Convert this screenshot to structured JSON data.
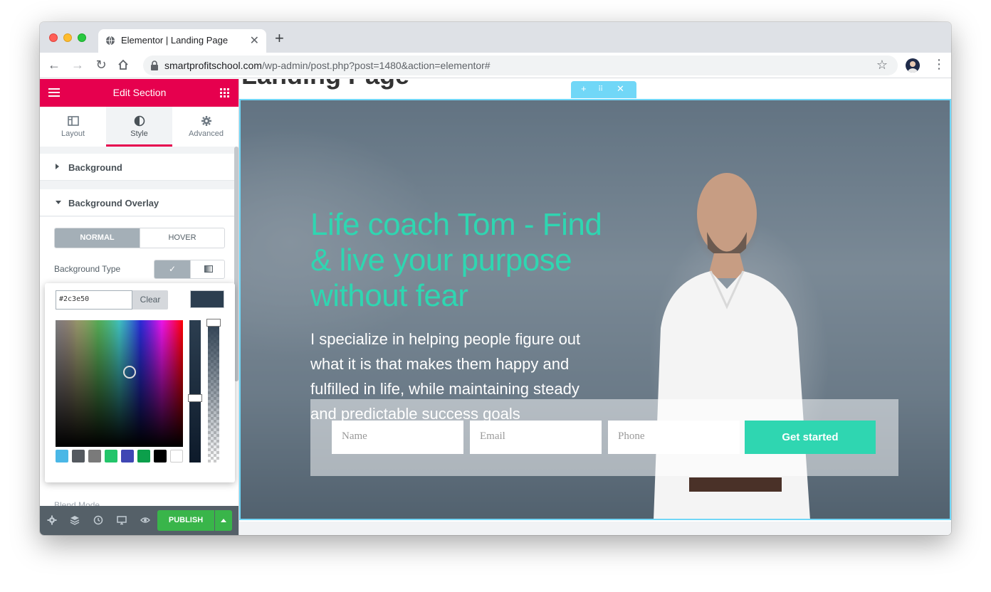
{
  "browser": {
    "tab_title": "Elementor | Landing Page",
    "url_host": "smartprofitschool.com",
    "url_path": "/wp-admin/post.php?post=1480&action=elementor#"
  },
  "panel": {
    "header_title": "Edit Section",
    "tabs": [
      {
        "label": "Layout",
        "icon": "layout-icon"
      },
      {
        "label": "Style",
        "icon": "half-circle-icon"
      },
      {
        "label": "Advanced",
        "icon": "gear-icon"
      }
    ],
    "sections": {
      "background": "Background",
      "background_overlay": "Background Overlay"
    },
    "state_tabs": {
      "normal": "NORMAL",
      "hover": "HOVER"
    },
    "background_type_label": "Background Type",
    "color_picker": {
      "hex_value": "#2c3e50",
      "clear_label": "Clear",
      "current_color": "#2c3e50",
      "presets": [
        "#4ab7e6",
        "#54595f",
        "#7a7a7a",
        "#23c56a",
        "#3f47b4",
        "#0c9f4b",
        "#000000",
        "#ffffff"
      ]
    },
    "footer": {
      "publish_label": "PUBLISH"
    }
  },
  "preview": {
    "page_heading": "Landing Page",
    "hero_title": "Life coach Tom - Find & live your purpose without fear",
    "hero_text": "I specialize in helping people figure out what it is that makes them happy and fulfilled in life, while maintaining steady and predictable success goals",
    "form": {
      "name_placeholder": "Name",
      "email_placeholder": "Email",
      "phone_placeholder": "Phone",
      "submit_label": "Get started"
    }
  },
  "colors": {
    "elementor_pink": "#e6004e",
    "accent_teal": "#2fd6b1",
    "selection_blue": "#71d7f7",
    "publish_green": "#39b54a"
  }
}
